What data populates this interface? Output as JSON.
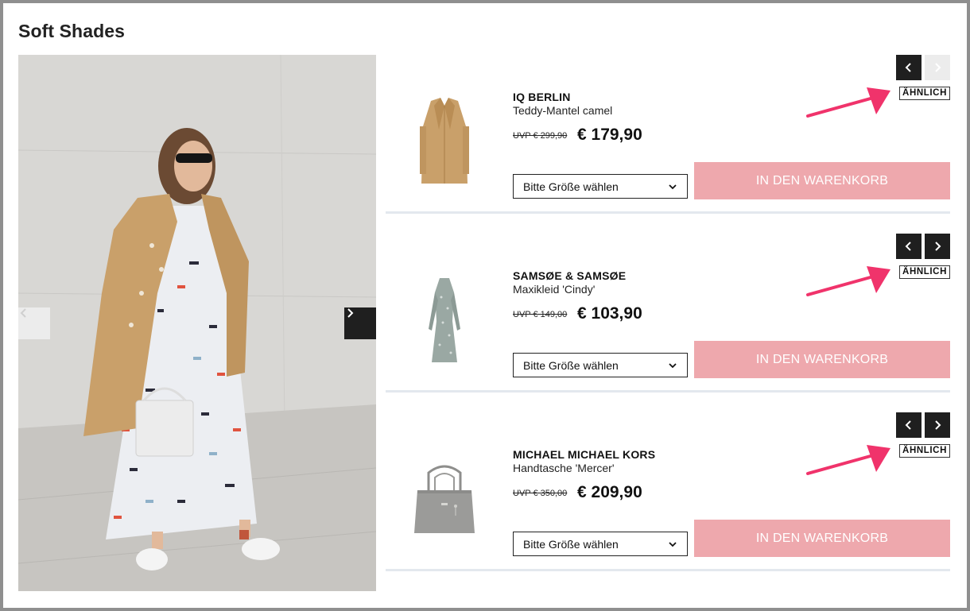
{
  "page": {
    "title": "Soft Shades"
  },
  "hero": {
    "prev_icon": "chevron-left-icon",
    "next_icon": "chevron-right-icon"
  },
  "products": [
    {
      "brand": "IQ BERLIN",
      "name": "Teddy-Mantel camel",
      "uvp": "UVP € 299,90",
      "price": "€ 179,90",
      "similar_label": "ÄHNLICH",
      "size_placeholder": "Bitte Größe wählen",
      "cart_label": "IN DEN WARENKORB",
      "prev_enabled": true,
      "next_enabled": false,
      "thumb_icon": "coat-image"
    },
    {
      "brand": "SAMSØE & SAMSØE",
      "name": "Maxikleid 'Cindy'",
      "uvp": "UVP € 149,00",
      "price": "€ 103,90",
      "similar_label": "ÄHNLICH",
      "size_placeholder": "Bitte Größe wählen",
      "cart_label": "IN DEN WARENKORB",
      "prev_enabled": true,
      "next_enabled": true,
      "thumb_icon": "dress-image"
    },
    {
      "brand": "MICHAEL MICHAEL KORS",
      "name": "Handtasche 'Mercer'",
      "uvp": "UVP € 350,00",
      "price": "€ 209,90",
      "similar_label": "ÄHNLICH",
      "size_placeholder": "Bitte Größe wählen",
      "cart_label": "IN DEN WARENKORB",
      "prev_enabled": true,
      "next_enabled": true,
      "thumb_icon": "handbag-image"
    }
  ],
  "colors": {
    "cart_button": "#eea8ad",
    "annotation_arrow": "#f0336b",
    "nav_dark": "#1f1f1f",
    "coat": "#c9a06a"
  }
}
